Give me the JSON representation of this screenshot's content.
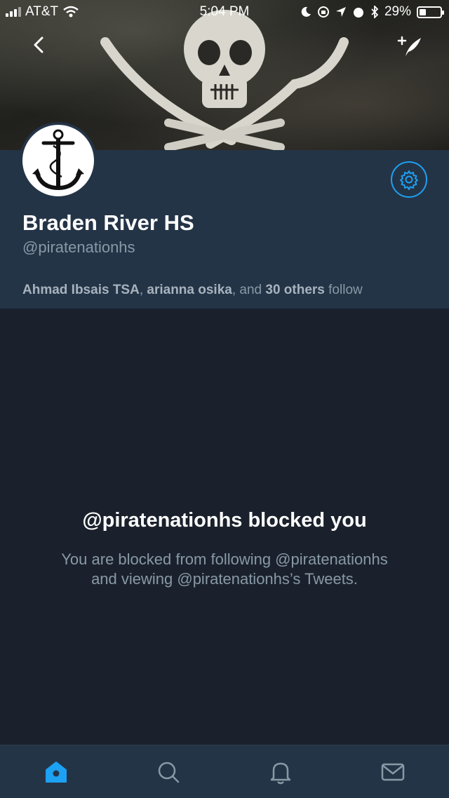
{
  "status_bar": {
    "carrier": "AT&T",
    "time": "5:04 PM",
    "battery": "29%"
  },
  "profile": {
    "display_name": "Braden River HS",
    "handle": "@piratenationhs",
    "followers_known": {
      "name1": "Ahmad Ibsais TSA",
      "sep1": ", ",
      "name2": "arianna osika",
      "sep2": ", and ",
      "others": "30 others",
      "suffix": " follow"
    }
  },
  "blocked": {
    "title": "@piratenationhs blocked you",
    "line1": "You are blocked from following @piratenationhs",
    "line2": "and viewing @piratenationhs’s Tweets."
  },
  "tabs": {
    "home_icon": "home-icon",
    "search_icon": "search-icon",
    "notifications_icon": "bell-icon",
    "messages_icon": "mail-icon"
  },
  "colors": {
    "accent": "#1da1f2",
    "header_bg": "#243447",
    "body_bg": "#1a212c",
    "muted_text": "#8899a6"
  }
}
